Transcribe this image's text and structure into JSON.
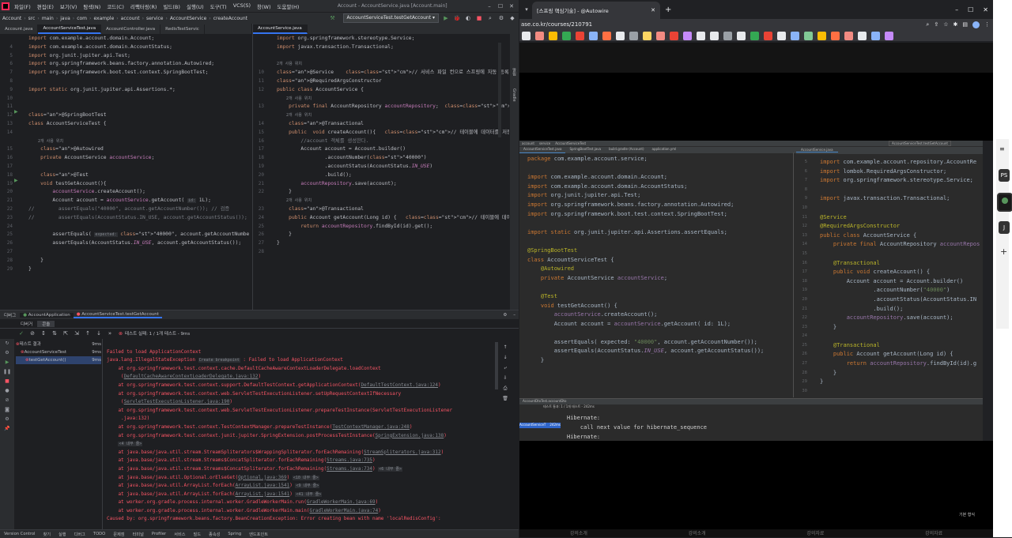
{
  "ide": {
    "menu": [
      "파일(F)",
      "편집(E)",
      "보기(V)",
      "탐색(N)",
      "코드(C)",
      "리팩터링(R)",
      "빌드(B)",
      "실행(U)",
      "도구(T)",
      "VCS(S)",
      "창(W)",
      "도움말(H)"
    ],
    "window_title": "Account - AccountService.java [Account.main]",
    "breadcrumbs": [
      "Account",
      "src",
      "main",
      "java",
      "com",
      "example",
      "account",
      "service",
      "AccountService",
      "createAccount"
    ],
    "run_config": "AccountServiceTest.testGetAccount",
    "left_tabs": [
      "Account.java",
      "AccountServiceTest.java",
      "AccountController.java",
      "RedisTestServic"
    ],
    "right_tabs": [
      "AccountService.java"
    ],
    "left_code": [
      {
        "n": "",
        "t": "import com.example.account.domain.Account;"
      },
      {
        "n": "4",
        "t": "import com.example.account.domain.AccountStatus;"
      },
      {
        "n": "5",
        "t": "import org.junit.jupiter.api.Test;"
      },
      {
        "n": "6",
        "t": "import org.springframework.beans.factory.annotation.Autowired;"
      },
      {
        "n": "7",
        "t": "import org.springframework.boot.test.context.SpringBootTest;"
      },
      {
        "n": "8",
        "t": ""
      },
      {
        "n": "9",
        "t": "import static org.junit.jupiter.api.Assertions.*;"
      },
      {
        "n": "10",
        "t": ""
      },
      {
        "n": "11",
        "t": ""
      },
      {
        "n": "12",
        "t": "@SpringBootTest"
      },
      {
        "n": "13",
        "t": "class AccountServiceTest {"
      },
      {
        "n": "14",
        "t": ""
      },
      {
        "n": "",
        "t": "    2개 사용 위치"
      },
      {
        "n": "15",
        "t": "    @Autowired"
      },
      {
        "n": "16",
        "t": "    private AccountService accountService;"
      },
      {
        "n": "17",
        "t": ""
      },
      {
        "n": "18",
        "t": "    @Test"
      },
      {
        "n": "19",
        "t": "    void testGetAccount(){"
      },
      {
        "n": "20",
        "t": "        accountService.createAccount();"
      },
      {
        "n": "21",
        "t": "        Account account = accountService.getAccount( id: 1L);"
      },
      {
        "n": "22",
        "t": "//        assertEquals(\"40000\", account.getAccountNumber()); // 검증"
      },
      {
        "n": "23",
        "t": "//        assertEquals(AccountStatus.IN_USE, account.getAccountStatus());"
      },
      {
        "n": "24",
        "t": ""
      },
      {
        "n": "25",
        "t": "        assertEquals( expected: \"40000\", account.getAccountNumber());"
      },
      {
        "n": "26",
        "t": "        assertEquals(AccountStatus.IN_USE, account.getAccountStatus());"
      },
      {
        "n": "27",
        "t": ""
      },
      {
        "n": "28",
        "t": "    }"
      },
      {
        "n": "29",
        "t": "}"
      }
    ],
    "right_code": [
      {
        "n": "",
        "t": "import org.springframework.stereotype.Service;"
      },
      {
        "n": "",
        "t": "import javax.transaction.Transactional;"
      },
      {
        "n": "",
        "t": ""
      },
      {
        "n": "",
        "t": "2개 사용 위치"
      },
      {
        "n": "10",
        "t": "@Service    // 서비스 파일 컨으로 스프링에 자동 등록해주기 위해서 붙인다."
      },
      {
        "n": "11",
        "t": "@RequiredArgsConstructor"
      },
      {
        "n": "12",
        "t": "public class AccountService {"
      },
      {
        "n": "",
        "t": "    2개 사용 위치"
      },
      {
        "n": "13",
        "t": "    private final AccountRepository accountRepository;  // 무조건 생성자에"
      },
      {
        "n": "",
        "t": "    2개 사용 위치"
      },
      {
        "n": "14",
        "t": "    @Transactional"
      },
      {
        "n": "15",
        "t": "    public  void createAccount(){   // 테이블에 데이터를 저장한다."
      },
      {
        "n": "16",
        "t": "        //account 객체를 생성한다."
      },
      {
        "n": "17",
        "t": "        Account account = Account.builder()"
      },
      {
        "n": "18",
        "t": "                .accountNumber(\"40000\")"
      },
      {
        "n": "19",
        "t": "                .accountStatus(AccountStatus.IN_USE)"
      },
      {
        "n": "20",
        "t": "                .build();"
      },
      {
        "n": "21",
        "t": "        accountRepository.save(account);"
      },
      {
        "n": "22",
        "t": "    }"
      },
      {
        "n": "",
        "t": "    2개 사용 위치"
      },
      {
        "n": "23",
        "t": "    @Transactional"
      },
      {
        "n": "24",
        "t": "    public Account getAccount(Long id) {   // 테이블에 데이터를 저장한다."
      },
      {
        "n": "25",
        "t": "        return accountRepository.findById(id).get();"
      },
      {
        "n": "26",
        "t": "    }"
      },
      {
        "n": "27",
        "t": "}"
      },
      {
        "n": "28",
        "t": ""
      }
    ],
    "bottom_tabs": [
      "AccountApplication",
      "AccountServiceTest.testGetAccount"
    ],
    "debug_tabs": [
      "디버거",
      "콘솔"
    ],
    "debug_label": "디버그",
    "test_status": "테스트 실패: 1 / 1개 테스트 - 9ms",
    "test_tree": [
      {
        "label": "테스트 결과",
        "time": "9ms"
      },
      {
        "label": "AccountServiceTest",
        "time": "9ms"
      },
      {
        "label": "testGetAccount()",
        "time": "9ms"
      }
    ],
    "console": [
      "",
      "Failed to load ApplicationContext",
      "java.lang.IllegalStateException Create breakpoint : Failed to load ApplicationContext",
      "    at org.springframework.test.context.cache.DefaultCacheAwareContextLoaderDelegate.loadContext",
      "     (DefaultCacheAwareContextLoaderDelegate.java:132)",
      "    at org.springframework.test.context.support.DefaultTestContext.getApplicationContext(DefaultTestContext.java:124)",
      "    at org.springframework.test.context.web.ServletTestExecutionListener.setUpRequestContextIfNecessary",
      "     (ServletTestExecutionListener.java:190)",
      "    at org.springframework.test.context.web.ServletTestExecutionListener.prepareTestInstance(ServletTestExecutionListener",
      "     .java:132)",
      "    at org.springframework.test.context.TestContextManager.prepareTestInstance(TestContextManager.java:248)",
      "    at org.springframework.test.context.junit.jupiter.SpringExtension.postProcessTestInstance(SpringExtension.java:138)",
      "    <4 내부 줄>",
      "    at java.base/java.util.stream.StreamSpliterators$WrappingSpliterator.forEachRemaining(StreamSpliterators.java:312)",
      "    at java.base/java.util.stream.Streams$ConcatSpliterator.forEachRemaining(Streams.java:735)",
      "    at java.base/java.util.stream.Streams$ConcatSpliterator.forEachRemaining(Streams.java:734) <6 내부 줄>",
      "    at java.base/java.util.Optional.orElseGet(Optional.java:369) <10 내부 줄>",
      "    at java.base/java.util.ArrayList.forEach(ArrayList.java:1541) <9 내부 줄>",
      "    at java.base/java.util.ArrayList.forEach(ArrayList.java:1541) <41 내부 줄>",
      "    at worker.org.gradle.process.internal.worker.GradleWorkerMain.run(GradleWorkerMain.java:69)",
      "    at worker.org.gradle.process.internal.worker.GradleWorkerMain.main(GradleWorkerMain.java:74)",
      "Caused by: org.springframework.beans.factory.BeanCreationException: Error creating bean with name 'localRedisConfig':"
    ],
    "statusbar": [
      "Version Control",
      "찾기",
      "실행",
      "디버그",
      "TODO",
      "문제점",
      "터미널",
      "Profiler",
      "서비스",
      "빌드",
      "종속성",
      "Spring",
      "엔드포인트"
    ],
    "side_labels": [
      "알림",
      "Gradle"
    ]
  },
  "browser": {
    "tab_title": "[스프링 핵심기술] - @Autowire",
    "url": "ase.co.kr/courses/210791",
    "video": {
      "breadcrumbs": [
        "account",
        "service",
        "AccountServiceTest"
      ],
      "run_config": "AccountServiceTest.testGetAccount",
      "tabs": [
        "AccountServiceTest.java",
        "SpringBootTest.java",
        "build.gradle (Account)",
        "application.yml"
      ],
      "right_tab": "AccountService.java",
      "left_code": [
        {
          "n": "",
          "t": "package com.example.account.service;"
        },
        {
          "n": "",
          "t": ""
        },
        {
          "n": "",
          "t": "import com.example.account.domain.Account;"
        },
        {
          "n": "",
          "t": "import com.example.account.domain.AccountStatus;"
        },
        {
          "n": "",
          "t": "import org.junit.jupiter.api.Test;"
        },
        {
          "n": "",
          "t": "import org.springframework.beans.factory.annotation.Autowired;"
        },
        {
          "n": "",
          "t": "import org.springframework.boot.test.context.SpringBootTest;"
        },
        {
          "n": "",
          "t": ""
        },
        {
          "n": "",
          "t": "import static org.junit.jupiter.api.Assertions.assertEquals;"
        },
        {
          "n": "",
          "t": ""
        },
        {
          "n": "",
          "t": "@SpringBootTest"
        },
        {
          "n": "",
          "t": "class AccountServiceTest {"
        },
        {
          "n": "",
          "t": "    @Autowired"
        },
        {
          "n": "",
          "t": "    private AccountService accountService;"
        },
        {
          "n": "",
          "t": ""
        },
        {
          "n": "",
          "t": "    @Test"
        },
        {
          "n": "",
          "t": "    void testGetAccount() {"
        },
        {
          "n": "",
          "t": "        accountService.createAccount();"
        },
        {
          "n": "",
          "t": "        Account account = accountService.getAccount( id: 1L);"
        },
        {
          "n": "",
          "t": ""
        },
        {
          "n": "",
          "t": "        assertEquals( expected: \"40000\", account.getAccountNumber());"
        },
        {
          "n": "",
          "t": "        assertEquals(AccountStatus.IN_USE, account.getAccountStatus());"
        },
        {
          "n": "",
          "t": "    }"
        }
      ],
      "right_code": [
        {
          "n": "5",
          "t": "import com.example.account.repository.AccountRe"
        },
        {
          "n": "6",
          "t": "import lombok.RequiredArgsConstructor;"
        },
        {
          "n": "7",
          "t": "import org.springframework.stereotype.Service;"
        },
        {
          "n": "8",
          "t": ""
        },
        {
          "n": "9",
          "t": "import javax.transaction.Transactional;"
        },
        {
          "n": "10",
          "t": ""
        },
        {
          "n": "11",
          "t": "@Service"
        },
        {
          "n": "12",
          "t": "@RequiredArgsConstructor"
        },
        {
          "n": "13",
          "t": "public class AccountService {"
        },
        {
          "n": "14",
          "t": "    private final AccountRepository accountRepos"
        },
        {
          "n": "15",
          "t": ""
        },
        {
          "n": "16",
          "t": "    @Transactional"
        },
        {
          "n": "17",
          "t": "    public void createAccount() {"
        },
        {
          "n": "18",
          "t": "        Account account = Account.builder()"
        },
        {
          "n": "19",
          "t": "                .accountNumber(\"40000\")"
        },
        {
          "n": "20",
          "t": "                .accountStatus(AccountStatus.IN"
        },
        {
          "n": "21",
          "t": "                .build();"
        },
        {
          "n": "22",
          "t": "        accountRepository.save(account);"
        },
        {
          "n": "23",
          "t": "    }"
        },
        {
          "n": "24",
          "t": ""
        },
        {
          "n": "25",
          "t": "    @Transactional"
        },
        {
          "n": "26",
          "t": "    public Account getAccount(Long id) {"
        },
        {
          "n": "27",
          "t": "        return accountRepository.findById(id).g"
        },
        {
          "n": "28",
          "t": "    }"
        },
        {
          "n": "29",
          "t": "}"
        },
        {
          "n": "30",
          "t": ""
        }
      ],
      "bottom_tab": "AccountDtoTest.accountDto",
      "console": [
        "Hibernate:",
        "    call next value for hibernate_sequence",
        "Hibernate:"
      ],
      "test_status": "테스트 통과: 1 / 1개 테스트 - 242ms",
      "test_item": "AccountServiceT",
      "test_time": "242ms",
      "status_right": "기본 형식"
    },
    "footer": [
      "강의소개",
      "강의소개",
      "강의자료",
      "강의자료"
    ]
  },
  "rightbar": {
    "badges": [
      "PS",
      "J"
    ]
  }
}
